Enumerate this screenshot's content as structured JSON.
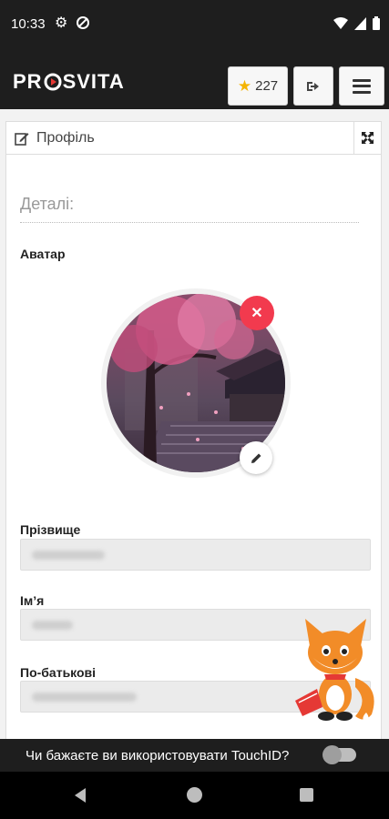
{
  "status_bar": {
    "time": "10:33"
  },
  "header": {
    "logo": "PROSVITA",
    "logo_left": "PR",
    "logo_right": "SVITA",
    "points": "227"
  },
  "panel": {
    "title": "Профіль"
  },
  "form": {
    "section_title": "Деталі:",
    "avatar_label": "Аватар",
    "surname_label": "Прізвище",
    "name_label": "Ім’я",
    "patronymic_label": "По-батькові"
  },
  "touchid": {
    "prompt": "Чи бажаєте ви використовувати TouchID?",
    "enabled": false
  },
  "colors": {
    "bar_bg": "#1e1e1e",
    "remove_red": "#f23a4e",
    "logo_red": "#e53935",
    "star": "#f4b400"
  },
  "icons": [
    "settings-icon",
    "notification-off-icon",
    "wifi-icon",
    "signal-icon",
    "battery-icon",
    "star-icon",
    "logout-icon",
    "menu-icon",
    "edit-icon",
    "expand-icon",
    "close-icon",
    "pencil-icon"
  ]
}
